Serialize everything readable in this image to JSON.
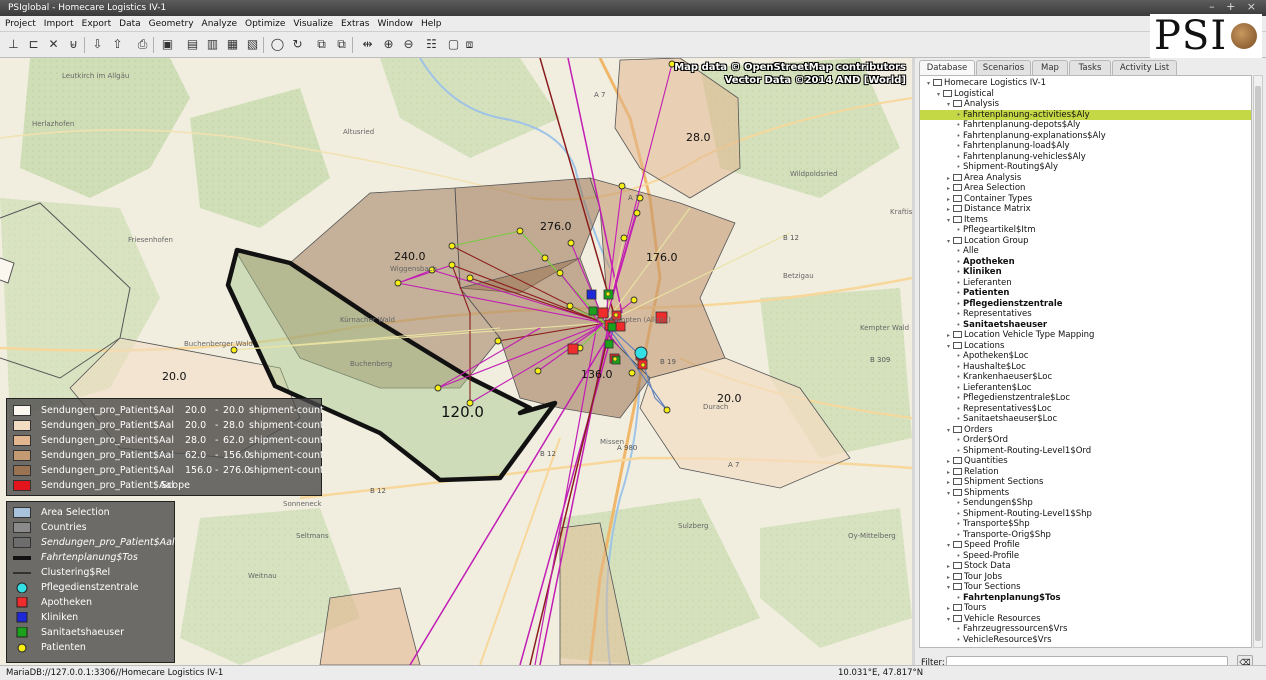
{
  "window": {
    "title": "PSIglobal - Homecare Logistics IV-1"
  },
  "menu": [
    "Project",
    "Import",
    "Export",
    "Data",
    "Geometry",
    "Analyze",
    "Optimize",
    "Visualize",
    "Extras",
    "Window",
    "Help"
  ],
  "toolbar_icons": [
    "new-icon",
    "open-icon",
    "delete-icon",
    "trash-icon",
    "import-icon",
    "export-icon",
    "print-icon",
    "map-icon",
    "doc-a-icon",
    "doc-b-icon",
    "doc-c-icon",
    "doc-d-icon",
    "zoom-window-icon",
    "refresh-icon",
    "layers-a-icon",
    "layers-b-icon",
    "fit-icon",
    "zoom-in-icon",
    "zoom-out-icon",
    "legend-icon",
    "frame-a-icon",
    "frame-b-icon"
  ],
  "logo": {
    "text": "PSI"
  },
  "map": {
    "attribution_line1": "Map data © OpenStreetMap contributors",
    "attribution_line2": "Vector Data ©2014 AND [World]",
    "area_labels": [
      "28.0",
      "276.0",
      "240.0",
      "176.0",
      "136.0",
      "20.0",
      "20.0",
      "120.0"
    ],
    "place_names": [
      "Leutkirch im Allgäu",
      "Herlazhofen",
      "Altusried",
      "Wildpoldsried",
      "Friesenhofen",
      "Wiggensbach",
      "Kürnacher Wald",
      "Buchenberg",
      "Buchenberger Wald",
      "Betzigau",
      "Kempter Wald",
      "Kempten (Allgäu)",
      "Durach",
      "Sulzberg",
      "Oy-Mittelberg",
      "Weitnau",
      "Seltmans",
      "Missen",
      "Sonneneck",
      "Kraftis"
    ],
    "road_labels": [
      "A 7",
      "A 7",
      "B 12",
      "B 12",
      "A 980",
      "A 7",
      "B 12",
      "B 19",
      "B 309"
    ]
  },
  "legend_top": {
    "rows": [
      {
        "label": "Sendungen_pro_Patient$Aal",
        "from": "20.0",
        "dash": "-",
        "to": "20.0",
        "unit": "shipment-count",
        "color": "#fbf7ef"
      },
      {
        "label": "Sendungen_pro_Patient$Aal",
        "from": "20.0",
        "dash": "-",
        "to": "28.0",
        "unit": "shipment-count",
        "color": "#f3ddc2"
      },
      {
        "label": "Sendungen_pro_Patient$Aal",
        "from": "28.0",
        "dash": "-",
        "to": "62.0",
        "unit": "shipment-count",
        "color": "#e2b78f"
      },
      {
        "label": "Sendungen_pro_Patient$Aal",
        "from": "62.0",
        "dash": "-",
        "to": "156.0",
        "unit": "shipment-count",
        "color": "#c49a73"
      },
      {
        "label": "Sendungen_pro_Patient$Aal",
        "from": "156.0",
        "dash": "-",
        "to": "276.0",
        "unit": "shipment-count",
        "color": "#9a7352"
      },
      {
        "label": "Sendungen_pro_Patient$Aal",
        "from": "",
        "dash": "",
        "to": "",
        "unit": "Scope",
        "color": "#e3141c"
      }
    ]
  },
  "legend_bottom": {
    "rows": [
      {
        "label": "Area Selection",
        "kind": "rect",
        "color": "#a9c2dc"
      },
      {
        "label": "Countries",
        "kind": "rect",
        "color": "#8a8a8a"
      },
      {
        "label": "Sendungen_pro_Patient$Aal",
        "kind": "rect",
        "color": "#6d6d6d",
        "italic": true
      },
      {
        "label": "Fahrtenplanung$Tos",
        "kind": "thickline",
        "color": "#111111",
        "italic": true
      },
      {
        "label": "Clustering$Rel",
        "kind": "line",
        "color": "#111111"
      },
      {
        "label": "Pflegedienstzentrale",
        "kind": "circle",
        "color": "#33e0e6"
      },
      {
        "label": "Apotheken",
        "kind": "square",
        "color": "#ef2b2b"
      },
      {
        "label": "Kliniken",
        "kind": "square",
        "color": "#1d29d8"
      },
      {
        "label": "Sanitaetshaeuser",
        "kind": "square",
        "color": "#1ba11b"
      },
      {
        "label": "Patienten",
        "kind": "dot",
        "color": "#f7ee13"
      }
    ]
  },
  "panel": {
    "tabs": [
      "Database",
      "Scenarios",
      "Map",
      "Tasks",
      "Activity List"
    ],
    "active_tab": "Database",
    "tree": [
      {
        "label": "Homecare Logistics IV-1",
        "lvl": 0,
        "kind": "folder",
        "tw": "▾"
      },
      {
        "label": "Logistical",
        "lvl": 1,
        "kind": "folder",
        "tw": "▾"
      },
      {
        "label": "Analysis",
        "lvl": 2,
        "kind": "folder",
        "tw": "▾"
      },
      {
        "label": "Fahrtenplanung-activities$Aly",
        "lvl": 3,
        "kind": "leaf",
        "sel": true
      },
      {
        "label": "Fahrtenplanung-depots$Aly",
        "lvl": 3,
        "kind": "leaf"
      },
      {
        "label": "Fahrtenplanung-explanations$Aly",
        "lvl": 3,
        "kind": "leaf"
      },
      {
        "label": "Fahrtenplanung-load$Aly",
        "lvl": 3,
        "kind": "leaf"
      },
      {
        "label": "Fahrtenplanung-vehicles$Aly",
        "lvl": 3,
        "kind": "leaf"
      },
      {
        "label": "Shipment-Routing$Aly",
        "lvl": 3,
        "kind": "leaf"
      },
      {
        "label": "Area Analysis",
        "lvl": 2,
        "kind": "folder",
        "tw": "▸"
      },
      {
        "label": "Area Selection",
        "lvl": 2,
        "kind": "folder",
        "tw": "▸"
      },
      {
        "label": "Container Types",
        "lvl": 2,
        "kind": "folder",
        "tw": "▸"
      },
      {
        "label": "Distance Matrix",
        "lvl": 2,
        "kind": "folder",
        "tw": "▸"
      },
      {
        "label": "Items",
        "lvl": 2,
        "kind": "folder",
        "tw": "▾"
      },
      {
        "label": "Pflegeartikel$Itm",
        "lvl": 3,
        "kind": "leaf"
      },
      {
        "label": "Location Group",
        "lvl": 2,
        "kind": "folder",
        "tw": "▾"
      },
      {
        "label": "Alle",
        "lvl": 3,
        "kind": "leaf"
      },
      {
        "label": "Apotheken",
        "lvl": 3,
        "kind": "leaf",
        "bold": true
      },
      {
        "label": "Kliniken",
        "lvl": 3,
        "kind": "leaf",
        "bold": true
      },
      {
        "label": "Lieferanten",
        "lvl": 3,
        "kind": "leaf"
      },
      {
        "label": "Patienten",
        "lvl": 3,
        "kind": "leaf",
        "bold": true
      },
      {
        "label": "Pflegedienstzentrale",
        "lvl": 3,
        "kind": "leaf",
        "bold": true
      },
      {
        "label": "Representatives",
        "lvl": 3,
        "kind": "leaf"
      },
      {
        "label": "Sanitaetshaeuser",
        "lvl": 3,
        "kind": "leaf",
        "bold": true
      },
      {
        "label": "Location Vehicle Type Mapping",
        "lvl": 2,
        "kind": "folder",
        "tw": "▸"
      },
      {
        "label": "Locations",
        "lvl": 2,
        "kind": "folder",
        "tw": "▾"
      },
      {
        "label": "Apotheken$Loc",
        "lvl": 3,
        "kind": "leaf"
      },
      {
        "label": "Haushalte$Loc",
        "lvl": 3,
        "kind": "leaf"
      },
      {
        "label": "Krankenhaeuser$Loc",
        "lvl": 3,
        "kind": "leaf"
      },
      {
        "label": "Lieferanten$Loc",
        "lvl": 3,
        "kind": "leaf"
      },
      {
        "label": "Pflegedienstzentrale$Loc",
        "lvl": 3,
        "kind": "leaf"
      },
      {
        "label": "Representatives$Loc",
        "lvl": 3,
        "kind": "leaf"
      },
      {
        "label": "Sanitaetshaeuser$Loc",
        "lvl": 3,
        "kind": "leaf"
      },
      {
        "label": "Orders",
        "lvl": 2,
        "kind": "folder",
        "tw": "▾"
      },
      {
        "label": "Order$Ord",
        "lvl": 3,
        "kind": "leaf"
      },
      {
        "label": "Shipment-Routing-Level1$Ord",
        "lvl": 3,
        "kind": "leaf"
      },
      {
        "label": "Quantities",
        "lvl": 2,
        "kind": "folder",
        "tw": "▸"
      },
      {
        "label": "Relation",
        "lvl": 2,
        "kind": "folder",
        "tw": "▸"
      },
      {
        "label": "Shipment Sections",
        "lvl": 2,
        "kind": "folder",
        "tw": "▸"
      },
      {
        "label": "Shipments",
        "lvl": 2,
        "kind": "folder",
        "tw": "▾"
      },
      {
        "label": "Sendungen$Shp",
        "lvl": 3,
        "kind": "leaf"
      },
      {
        "label": "Shipment-Routing-Level1$Shp",
        "lvl": 3,
        "kind": "leaf"
      },
      {
        "label": "Transporte$Shp",
        "lvl": 3,
        "kind": "leaf"
      },
      {
        "label": "Transporte-Orig$Shp",
        "lvl": 3,
        "kind": "leaf"
      },
      {
        "label": "Speed Profile",
        "lvl": 2,
        "kind": "folder",
        "tw": "▾"
      },
      {
        "label": "Speed-Profile",
        "lvl": 3,
        "kind": "leaf"
      },
      {
        "label": "Stock Data",
        "lvl": 2,
        "kind": "folder",
        "tw": "▸"
      },
      {
        "label": "Tour Jobs",
        "lvl": 2,
        "kind": "folder",
        "tw": "▸"
      },
      {
        "label": "Tour Sections",
        "lvl": 2,
        "kind": "folder",
        "tw": "▾"
      },
      {
        "label": "Fahrtenplanung$Tos",
        "lvl": 3,
        "kind": "leaf",
        "bold": true
      },
      {
        "label": "Tours",
        "lvl": 2,
        "kind": "folder",
        "tw": "▸"
      },
      {
        "label": "Vehicle Resources",
        "lvl": 2,
        "kind": "folder",
        "tw": "▾"
      },
      {
        "label": "Fahrzeugressourcen$Vrs",
        "lvl": 3,
        "kind": "leaf"
      },
      {
        "label": "VehicleResource$Vrs",
        "lvl": 3,
        "kind": "leaf"
      }
    ],
    "filter_label": "Filter:",
    "filter_value": ""
  },
  "status": {
    "connection": "MariaDB://127.0.0.1:3306//Homecare Logistics IV-1",
    "coords": "10.031°E, 47.817°N"
  }
}
